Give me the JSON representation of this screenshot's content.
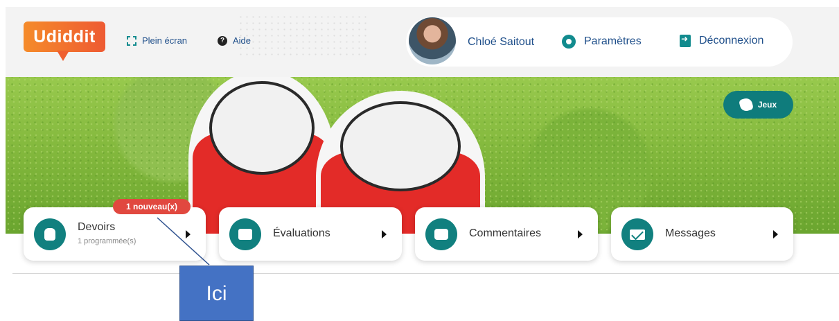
{
  "header": {
    "logo_text": "Udiddit",
    "fullscreen_label": "Plein écran",
    "help_label": "Aide",
    "user_name": "Chloé Saitout",
    "settings_label": "Paramètres",
    "logout_label": "Déconnexion"
  },
  "banner": {
    "games_label": "Jeux"
  },
  "cards": [
    {
      "title": "Devoirs",
      "subtitle": "1 programmée(s)",
      "badge": "1 nouveau(x)",
      "icon": "backpack-icon"
    },
    {
      "title": "Évaluations",
      "icon": "clipboard-icon"
    },
    {
      "title": "Commentaires",
      "icon": "comments-icon"
    },
    {
      "title": "Messages",
      "icon": "envelope-icon"
    }
  ],
  "annotation": {
    "label": "Ici"
  },
  "colors": {
    "accent_teal": "#11807f",
    "badge_red": "#e1483f",
    "logo_orange": "#f58b2a",
    "annotation_blue": "#4472c4",
    "link_blue": "#1f4f8a"
  }
}
